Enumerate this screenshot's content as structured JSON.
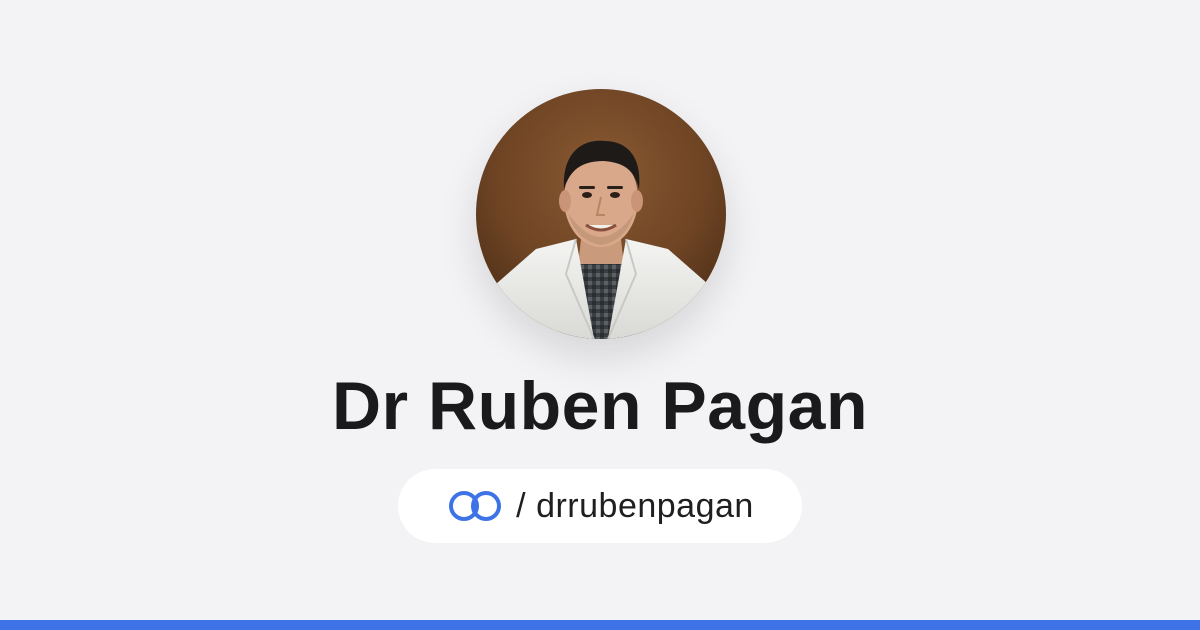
{
  "profile": {
    "name": "Dr Ruben Pagan",
    "separator": "/",
    "handle": "drrubenpagan",
    "avatar_alt": "Profile photo"
  },
  "icons": {
    "logo": "linked-rings-icon"
  },
  "colors": {
    "background": "#f3f3f6",
    "accent": "#3d73e6",
    "pill": "#ffffff",
    "text": "#1a1a1c"
  }
}
